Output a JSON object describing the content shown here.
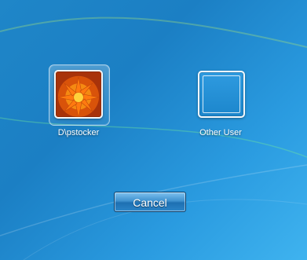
{
  "users": [
    {
      "name": "D\\pstocker",
      "avatar": "flower-avatar",
      "selected": true
    },
    {
      "name": "Other User",
      "avatar": "blank-avatar",
      "selected": false
    }
  ],
  "buttons": {
    "cancel_label": "Cancel"
  },
  "colors": {
    "background": "#1f86c8",
    "button": "#2c86c8"
  }
}
